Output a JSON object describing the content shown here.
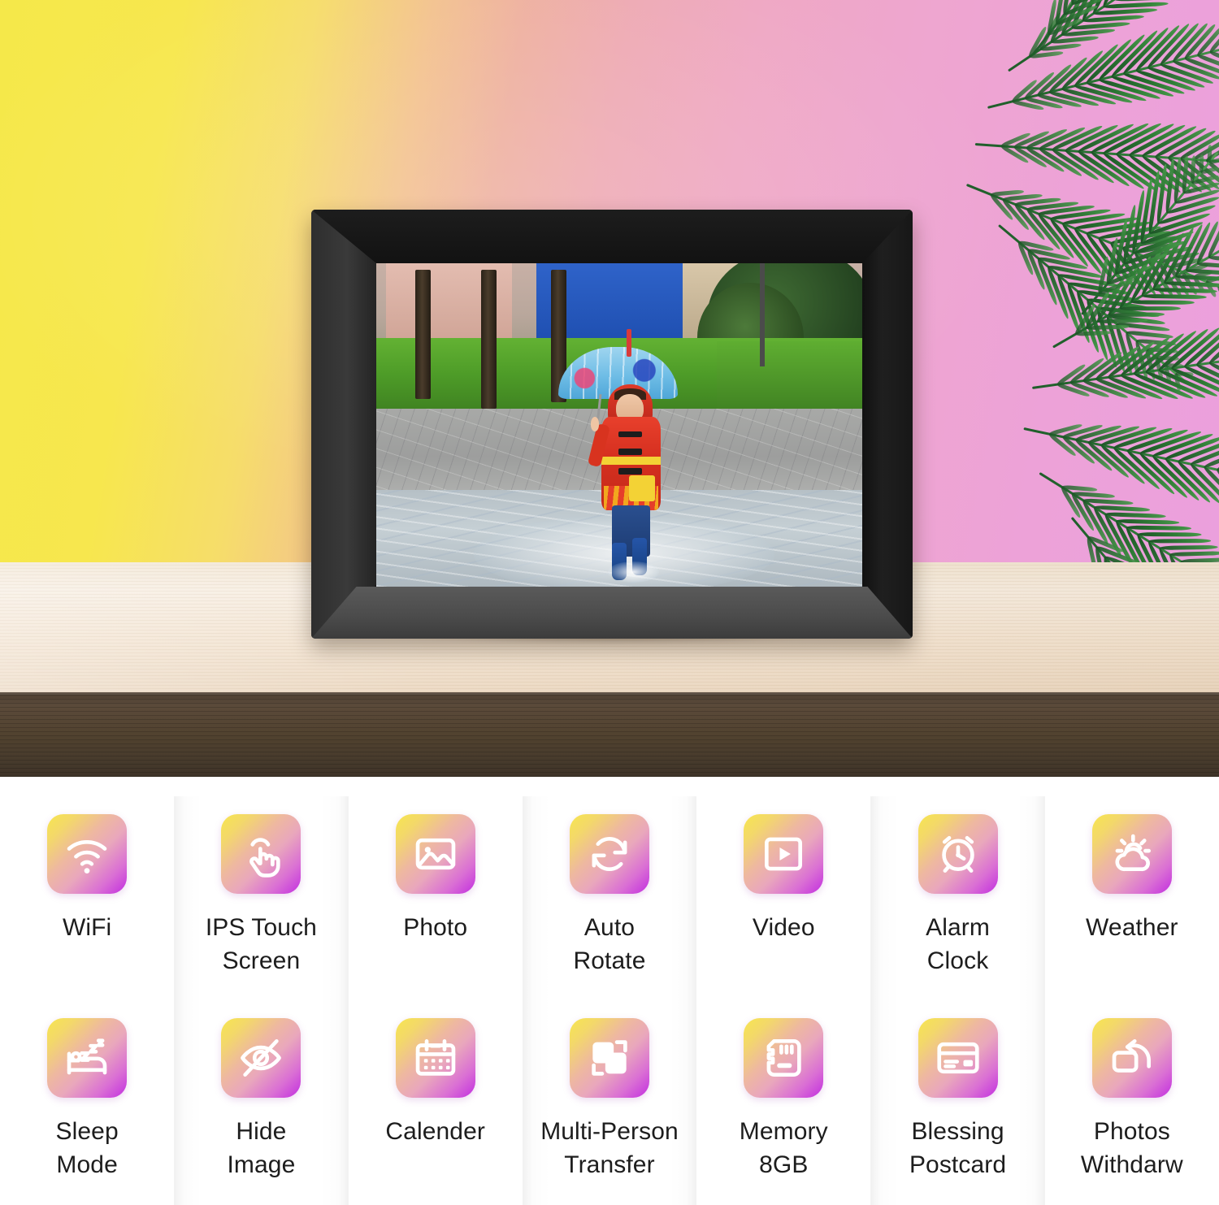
{
  "scene": {
    "name": "digital-photo-frame-on-wooden-shelf",
    "wall_gradient": [
      "#f5e84a",
      "#eeaab4",
      "#eba0dd"
    ],
    "shelf_top_color": "#f3e4d2",
    "shelf_edge_color": "#4d3f32",
    "frame_color": "#141414",
    "plant": "areca-palm",
    "photo_subject": "child in red firefighter raincoat holding blue umbrella walking through puddle"
  },
  "features": {
    "rows": [
      {
        "cells": [
          {
            "icon": "wifi-icon",
            "label": "WiFi"
          },
          {
            "icon": "touch-hand-icon",
            "label": "IPS Touch\nScreen"
          },
          {
            "icon": "photo-icon",
            "label": "Photo"
          },
          {
            "icon": "auto-rotate-icon",
            "label": "Auto\nRotate"
          },
          {
            "icon": "video-icon",
            "label": "Video"
          },
          {
            "icon": "alarm-clock-icon",
            "label": "Alarm\nClock"
          },
          {
            "icon": "weather-icon",
            "label": "Weather"
          }
        ]
      },
      {
        "cells": [
          {
            "icon": "sleep-bed-icon",
            "label": "Sleep\nMode"
          },
          {
            "icon": "hide-eye-icon",
            "label": "Hide\nImage"
          },
          {
            "icon": "calendar-icon",
            "label": "Calender"
          },
          {
            "icon": "multi-transfer-icon",
            "label": "Multi-Person\nTransfer"
          },
          {
            "icon": "memory-card-icon",
            "label": "Memory\n8GB"
          },
          {
            "icon": "postcard-icon",
            "label": "Blessing\nPostcard"
          },
          {
            "icon": "photo-withdraw-icon",
            "label": "Photos\nWithdarw"
          }
        ]
      }
    ],
    "tile_gradient": [
      "#f7e64f",
      "#e9a7bc",
      "#c22ee0"
    ],
    "label_color": "#1d1d1d"
  }
}
